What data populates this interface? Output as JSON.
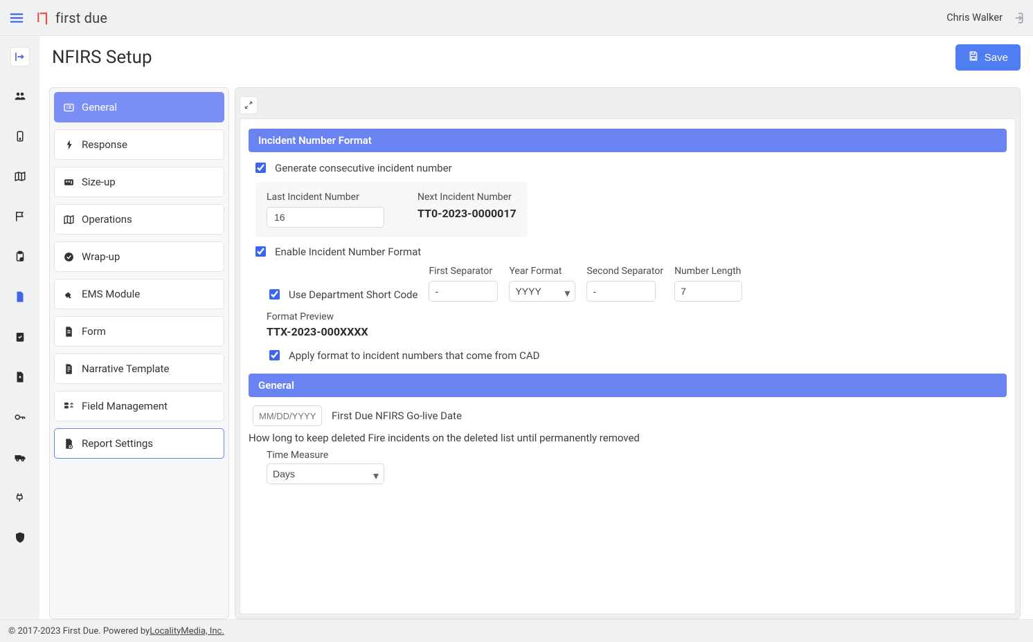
{
  "header": {
    "brand_text": "first due",
    "user_name": "Chris Walker"
  },
  "page": {
    "title": "NFIRS Setup",
    "save_label": "Save"
  },
  "tabs": [
    {
      "id": "general",
      "label": "General",
      "active": true
    },
    {
      "id": "response",
      "label": "Response"
    },
    {
      "id": "sizeup",
      "label": "Size-up"
    },
    {
      "id": "operations",
      "label": "Operations"
    },
    {
      "id": "wrapup",
      "label": "Wrap-up"
    },
    {
      "id": "ems",
      "label": "EMS Module"
    },
    {
      "id": "form",
      "label": "Form"
    },
    {
      "id": "narrative",
      "label": "Narrative Template"
    },
    {
      "id": "field",
      "label": "Field Management"
    },
    {
      "id": "report",
      "label": "Report Settings",
      "current": true
    }
  ],
  "incident_format": {
    "section_title": "Incident Number Format",
    "generate_label": "Generate consecutive incident number",
    "generate_checked": true,
    "last_label": "Last Incident Number",
    "last_value": "16",
    "next_label": "Next Incident Number",
    "next_value": "TT0-2023-0000017",
    "enable_label": "Enable Incident Number Format",
    "enable_checked": true,
    "use_short_label": "Use Department Short Code",
    "use_short_checked": true,
    "first_sep_label": "First Separator",
    "first_sep_value": "-",
    "year_label": "Year Format",
    "year_value": "YYYY",
    "sec_sep_label": "Second Separator",
    "sec_sep_value": "-",
    "numlen_label": "Number Length",
    "numlen_value": "7",
    "preview_label": "Format Preview",
    "preview_value": "TTX-2023-000XXXX",
    "apply_cad_label": "Apply format to incident numbers that come from CAD",
    "apply_cad_checked": true
  },
  "general": {
    "section_title": "General",
    "date_placeholder": "MM/DD/YYYY",
    "date_label": "First Due NFIRS Go-live Date",
    "note": "How long to keep deleted Fire incidents on the deleted list until permanently removed",
    "time_measure_label": "Time Measure",
    "time_measure_value": "Days"
  },
  "footer": {
    "prefix": "© 2017-2023 First Due. Powered by ",
    "link": "LocalityMedia, Inc."
  }
}
